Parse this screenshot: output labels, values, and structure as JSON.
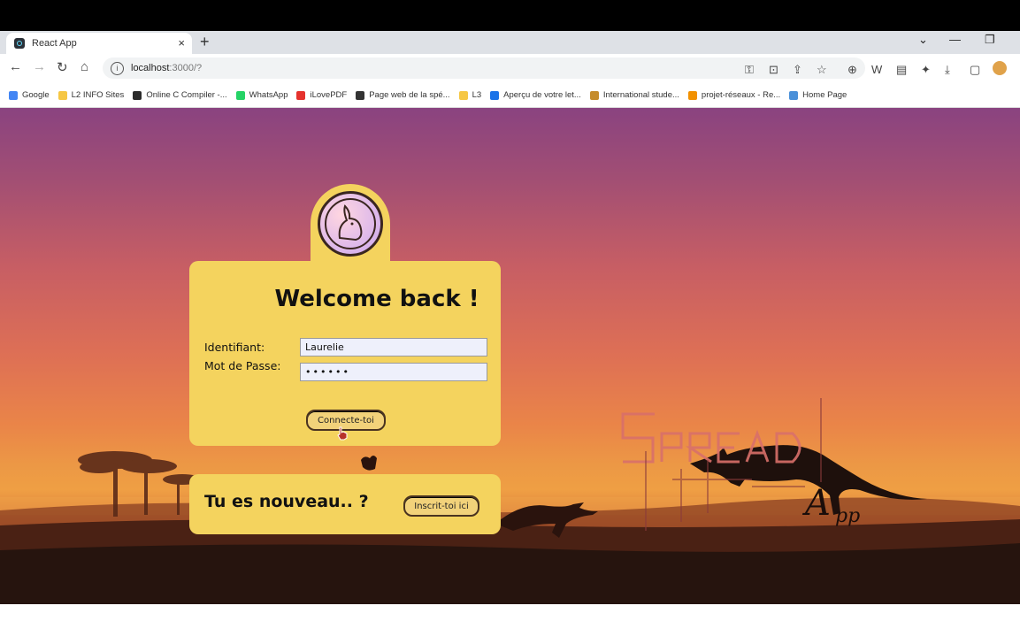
{
  "browser": {
    "tab_title": "React App",
    "tab_close": "×",
    "new_tab": "+",
    "url_host": "localhost",
    "url_rest": ":3000/?",
    "bookmarks": [
      {
        "label": "Google",
        "color": "#4285f4"
      },
      {
        "label": "L2 INFO Sites",
        "color": "#f6c744"
      },
      {
        "label": "Online C Compiler -...",
        "color": "#2b2b2b"
      },
      {
        "label": "WhatsApp",
        "color": "#25d366"
      },
      {
        "label": "iLovePDF",
        "color": "#e5322d"
      },
      {
        "label": "Page web de la spé...",
        "color": "#333333"
      },
      {
        "label": "L3",
        "color": "#f6c744"
      },
      {
        "label": "Aperçu de votre let...",
        "color": "#1a73e8"
      },
      {
        "label": "International stude...",
        "color": "#c58b2a"
      },
      {
        "label": "projet-réseaux - Re...",
        "color": "#f29100"
      },
      {
        "label": "Home Page",
        "color": "#4a90d9"
      }
    ]
  },
  "login": {
    "title": "Welcome back !",
    "id_label": "Identifiant:",
    "id_value": "Laurelie",
    "pw_label": "Mot de Passe:",
    "pw_value": "••••••",
    "submit_label": "Connecte-toi"
  },
  "signup": {
    "question": "Tu es nouveau.. ?",
    "button_label": "Inscrit-toi ici"
  },
  "brand": {
    "word1": "SPREAD",
    "word2": "App"
  },
  "colors": {
    "card": "#f4d35e",
    "sky_top": "#8a4380",
    "sky_bottom": "#ef9f44"
  }
}
